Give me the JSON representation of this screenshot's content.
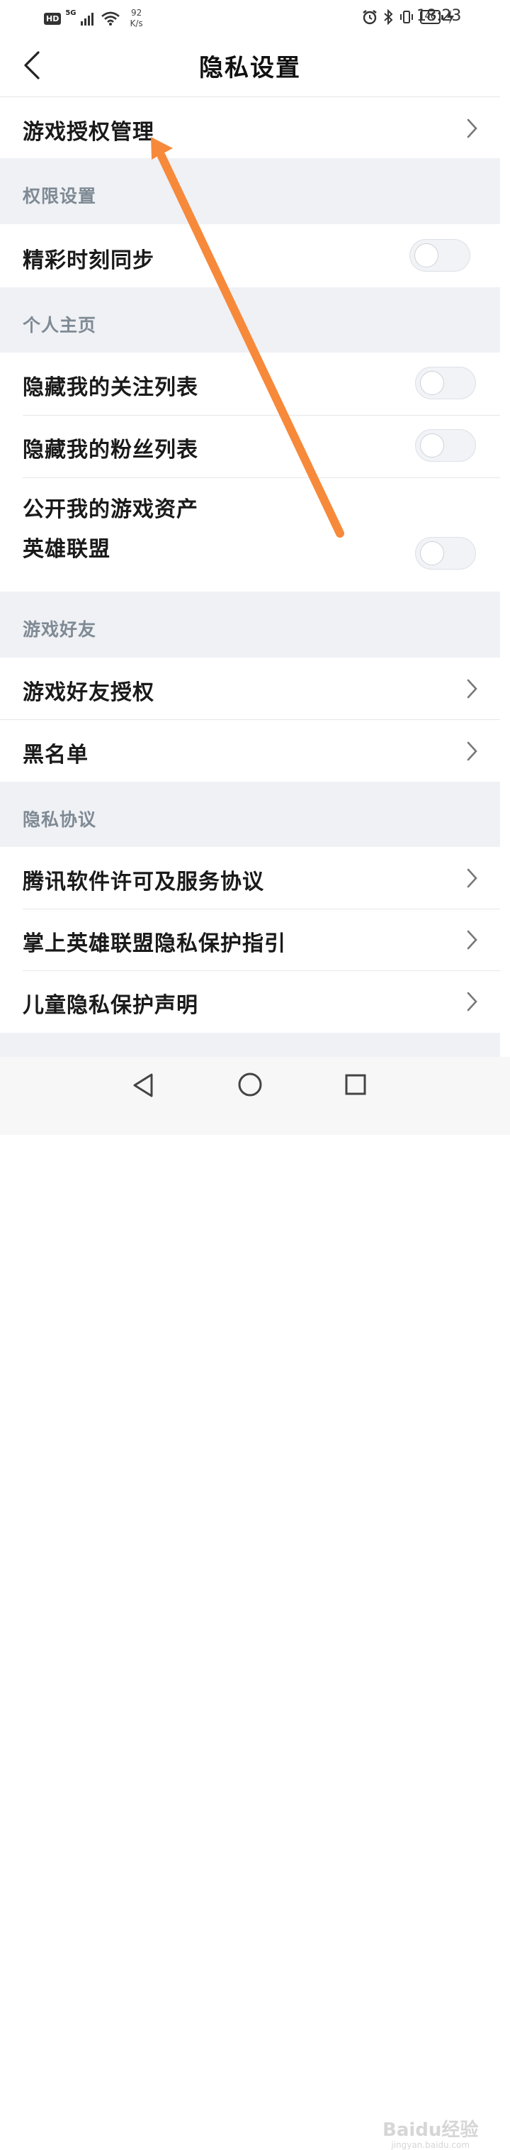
{
  "status_bar": {
    "hd": "HD",
    "network_gen": "5G",
    "net_speed_value": "92",
    "net_speed_unit": "K/s",
    "battery": "46",
    "time": "18:23"
  },
  "header": {
    "title": "隐私设置"
  },
  "rows": {
    "game_auth": "游戏授权管理",
    "section_permissions": "权限设置",
    "highlight_sync": "精彩时刻同步",
    "section_profile": "个人主页",
    "hide_following": "隐藏我的关注列表",
    "hide_fans": "隐藏我的粉丝列表",
    "public_assets": "公开我的游戏资产",
    "public_assets_game": "英雄联盟",
    "section_friends": "游戏好友",
    "friend_auth": "游戏好友授权",
    "blacklist": "黑名单",
    "section_agreements": "隐私协议",
    "tencent_license": "腾讯软件许可及服务协议",
    "privacy_guide": "掌上英雄联盟隐私保护指引",
    "child_privacy": "儿童隐私保护声明"
  },
  "toggles": {
    "highlight_sync": false,
    "hide_following": false,
    "hide_fans": false,
    "public_assets": false
  },
  "watermark": {
    "brand": "Baidu经验",
    "domain": "jingyan.baidu.com"
  },
  "colors": {
    "annotation_arrow": "#f7893b",
    "section_bg": "#eff1f5",
    "section_text": "#7f8a94"
  }
}
